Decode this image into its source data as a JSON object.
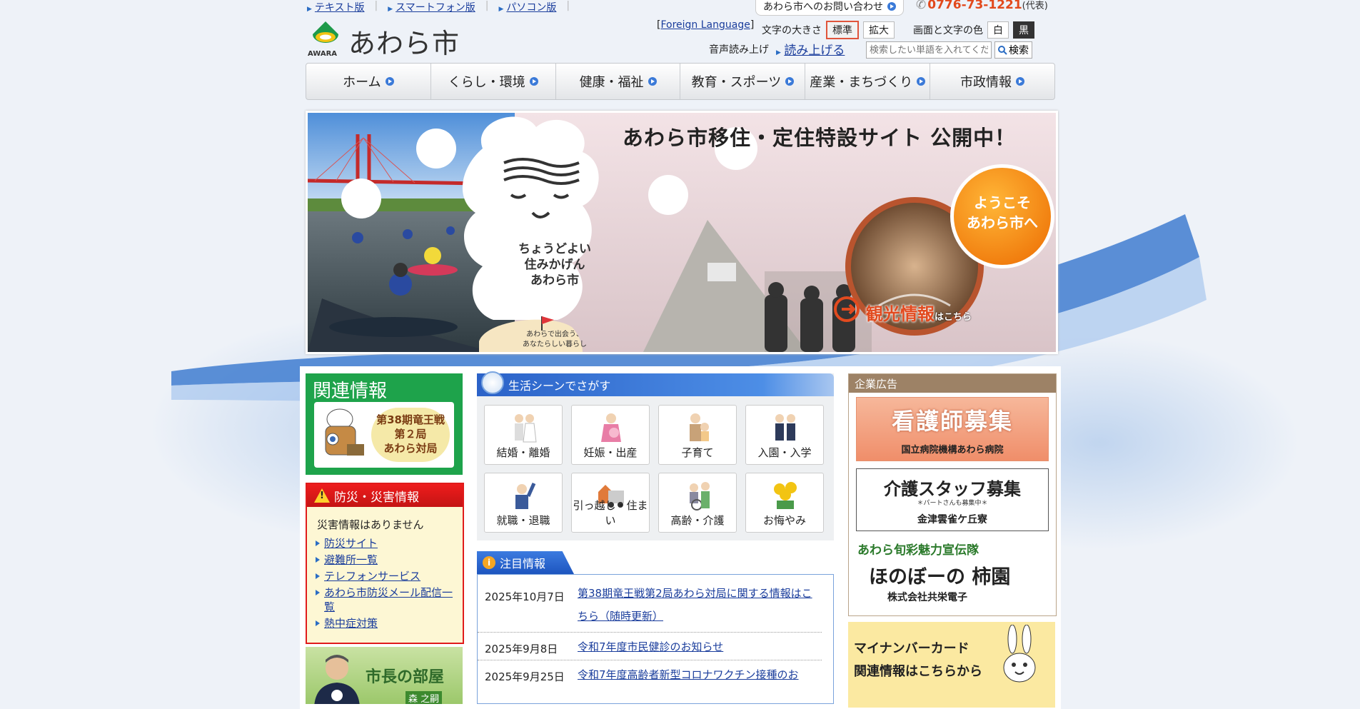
{
  "top_links": [
    "テキスト版",
    "スマートフォン版",
    "パソコン版"
  ],
  "contact": {
    "label": "あわら市へのお問い合わせ",
    "phone": "0776-73-1221",
    "phone_note": "(代表)"
  },
  "logo": {
    "name": "あわら市",
    "en": "AWARA"
  },
  "foreign_language": "Foreign Language",
  "font_size": {
    "label": "文字の大きさ",
    "standard": "標準",
    "enlarge": "拡大"
  },
  "color": {
    "label": "画面と文字の色",
    "white": "白",
    "black": "黒"
  },
  "voice": {
    "label": "音声読み上げ",
    "link": "読み上げる"
  },
  "search": {
    "placeholder": "検索したい単語を入れてください",
    "button": "検索"
  },
  "nav": [
    "ホーム",
    "くらし・環境",
    "健康・福祉",
    "教育・スポーツ",
    "産業・まちづくり",
    "市政情報"
  ],
  "hero": {
    "title": "あわら市移住・定住特設サイト 公開中！",
    "cloud_text": [
      "ちょうどよい",
      "住みかげん",
      "あわら市"
    ],
    "cloud_sub": [
      "あわらで出会う、",
      "あなたらしい暮らし"
    ],
    "welcome": [
      "ようこそ",
      "あわら市へ"
    ],
    "sightseeing": "観光情報",
    "sightseeing_suffix": "はこちら"
  },
  "related": {
    "title": "関連情報",
    "badge": [
      "第38期竜王戦",
      "第２局",
      "あわら対局"
    ]
  },
  "disaster": {
    "title": "防災・災害情報",
    "status": "災害情報はありません",
    "links": [
      "防災サイト",
      "避難所一覧",
      "テレフォンサービス",
      "あわら市防災メール配信一覧",
      "熱中症対策"
    ]
  },
  "mayor": {
    "title": "市長の部屋",
    "name": "森 之嗣"
  },
  "life": {
    "title": "生活シーンでさがす",
    "items": [
      "結婚・離婚",
      "妊娠・出産",
      "子育て",
      "入園・入学",
      "就職・退職",
      "引っ越し・住まい",
      "高齢・介護",
      "お悔やみ"
    ]
  },
  "notice": {
    "title": "注目情報",
    "items": [
      {
        "date": "2025年10月7日",
        "text": "第38期竜王戦第2局あわら対局に関する情報はこちら（随時更新）"
      },
      {
        "date": "2025年9月8日",
        "text": "令和7年度市民健診のお知らせ"
      },
      {
        "date": "2025年9月25日",
        "text": "令和7年度高齢者新型コロナワクチン接種のお"
      }
    ]
  },
  "ads": {
    "title": "企業広告",
    "ad1": {
      "title": "看護師募集",
      "sub": "国立病院機構あわら病院"
    },
    "ad2": {
      "title": "介護スタッフ募集",
      "mid": "＊パートさんも募集中＊",
      "sub": "金津雲雀ケ丘寮"
    },
    "ad3": {
      "line1": "あわら旬彩魅力宣伝隊",
      "line2": "ほのぼーの 柿園",
      "line3": "株式会社共栄電子"
    }
  },
  "mynumber": {
    "lines": [
      "マイナンバーカード",
      "関連情報はこちらから"
    ]
  }
}
